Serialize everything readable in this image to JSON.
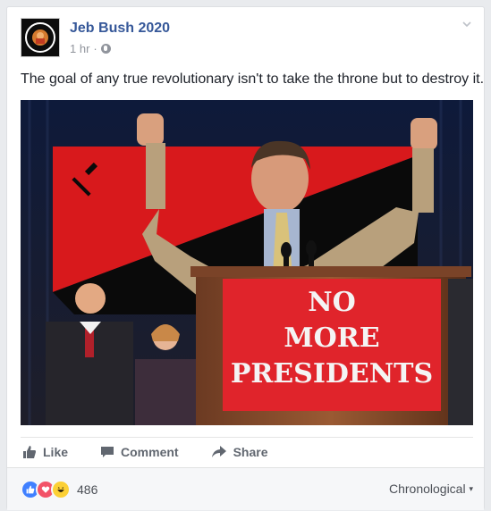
{
  "post": {
    "author": "Jeb Bush 2020",
    "timestamp": "1 hr",
    "separator": "·",
    "text": "The goal of any true revolutionary isn't to take the throne but to destroy it.",
    "avatar_text_top": "GOOD NIGHT",
    "avatar_text_bottom": "ALT-RIGHT"
  },
  "photo": {
    "sign_line1": "NO",
    "sign_line2": "MORE",
    "sign_line3": "PRESIDENTS"
  },
  "actions": {
    "like": "Like",
    "comment": "Comment",
    "share": "Share"
  },
  "footer": {
    "reaction_icons": [
      "like-icon",
      "love-icon",
      "haha-icon"
    ],
    "reaction_count": "486",
    "order_label": "Chronological"
  },
  "colors": {
    "link": "#365899",
    "sign_red": "#e0242b",
    "flag_red": "#d8191c",
    "text": "#1d2129"
  }
}
